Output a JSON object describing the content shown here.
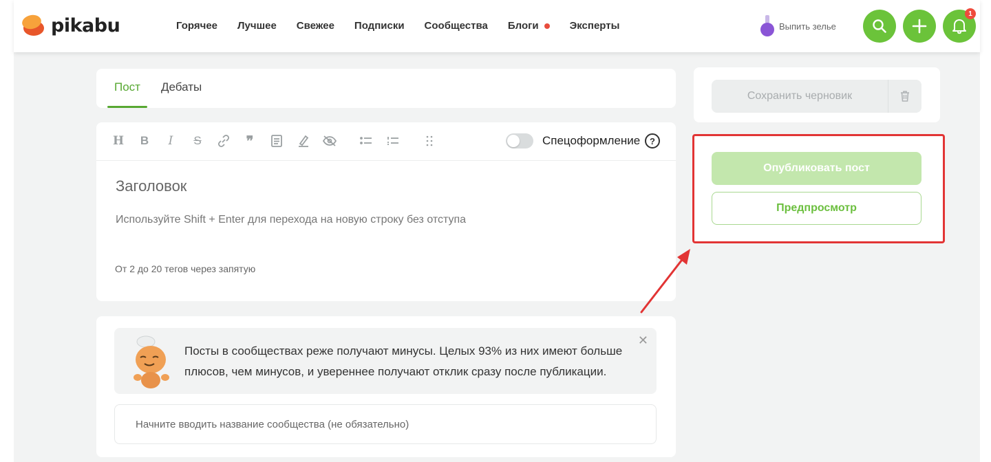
{
  "header": {
    "logo_text": "pikabu",
    "nav": [
      {
        "label": "Горячее"
      },
      {
        "label": "Лучшее"
      },
      {
        "label": "Свежее"
      },
      {
        "label": "Подписки"
      },
      {
        "label": "Сообщества"
      },
      {
        "label": "Блоги",
        "has_dot": true
      },
      {
        "label": "Эксперты"
      }
    ],
    "potion_label": "Выпить зелье",
    "notifications_count": "1",
    "icons": [
      "potion-icon",
      "search-icon",
      "plus-icon",
      "bell-icon"
    ],
    "accent_color": "#6bc33a"
  },
  "tabs": [
    {
      "label": "Пост",
      "active": true
    },
    {
      "label": "Дебаты",
      "active": false
    }
  ],
  "editor": {
    "toolbar_icons": [
      "heading-icon",
      "bold-icon",
      "italic-icon",
      "strikethrough-icon",
      "link-icon",
      "quote-icon",
      "document-icon",
      "marker-icon",
      "hide-icon",
      "bullet-list-icon",
      "numbered-list-icon",
      "drag-handle-icon"
    ],
    "heading_glyph": "H",
    "bold_glyph": "B",
    "italic_glyph": "I",
    "strike_glyph": "S",
    "quote_glyph": "❞",
    "special_format_label": "Спецоформление",
    "special_format_enabled": false,
    "help_glyph": "?",
    "title_placeholder": "Заголовок",
    "body_placeholder": "Используйте Shift + Enter для перехода на новую строку без отступа",
    "tags_placeholder": "От 2 до 20 тегов через запятую"
  },
  "community": {
    "tip_text": "Посты в сообществах реже получают минусы. Целых 93% из них имеют больше плюсов, чем минусов, и увереннее получают отклик сразу после публикации.",
    "close_glyph": "✕",
    "input_placeholder": "Начните вводить название сообщества (не обязательно)"
  },
  "sidebar": {
    "save_draft_label": "Сохранить черновик",
    "publish_label": "Опубликовать пост",
    "preview_label": "Предпросмотр",
    "highlight_color": "#e23434"
  }
}
